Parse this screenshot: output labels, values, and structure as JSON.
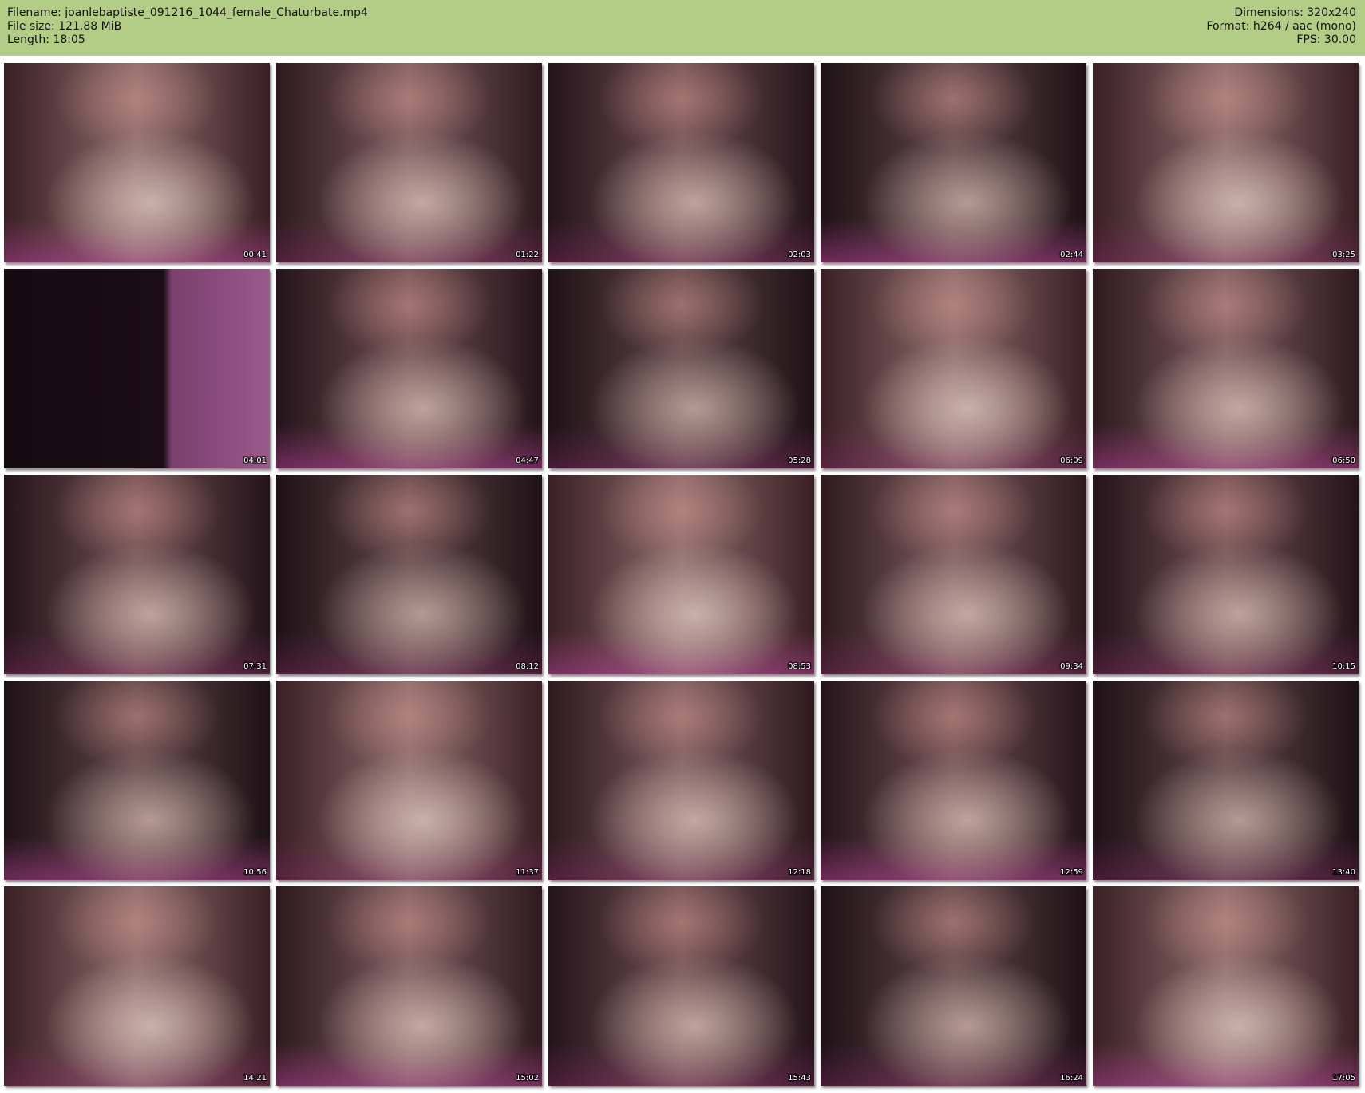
{
  "header": {
    "filename_line": "Filename: joanlebaptiste_091216_1044_female_Chaturbate.mp4",
    "filesize_line": "File size: 121.88 MiB",
    "length_line": "Length: 18:05",
    "dimensions_line": "Dimensions: 320x240",
    "format_line": "Format: h264 / aac (mono)",
    "fps_line": "FPS: 30.00"
  },
  "colors": {
    "header_bg": "#b2cd85",
    "page_bg": "#ffffff"
  },
  "thumbnails": [
    {
      "timestamp": "00:41"
    },
    {
      "timestamp": "01:22"
    },
    {
      "timestamp": "02:03"
    },
    {
      "timestamp": "02:44"
    },
    {
      "timestamp": "03:25"
    },
    {
      "timestamp": "04:01"
    },
    {
      "timestamp": "04:47"
    },
    {
      "timestamp": "05:28"
    },
    {
      "timestamp": "06:09"
    },
    {
      "timestamp": "06:50"
    },
    {
      "timestamp": "07:31"
    },
    {
      "timestamp": "08:12"
    },
    {
      "timestamp": "08:53"
    },
    {
      "timestamp": "09:34"
    },
    {
      "timestamp": "10:15"
    },
    {
      "timestamp": "10:56"
    },
    {
      "timestamp": "11:37"
    },
    {
      "timestamp": "12:18"
    },
    {
      "timestamp": "12:59"
    },
    {
      "timestamp": "13:40"
    },
    {
      "timestamp": "14:21"
    },
    {
      "timestamp": "15:02"
    },
    {
      "timestamp": "15:43"
    },
    {
      "timestamp": "16:24"
    },
    {
      "timestamp": "17:05"
    }
  ]
}
